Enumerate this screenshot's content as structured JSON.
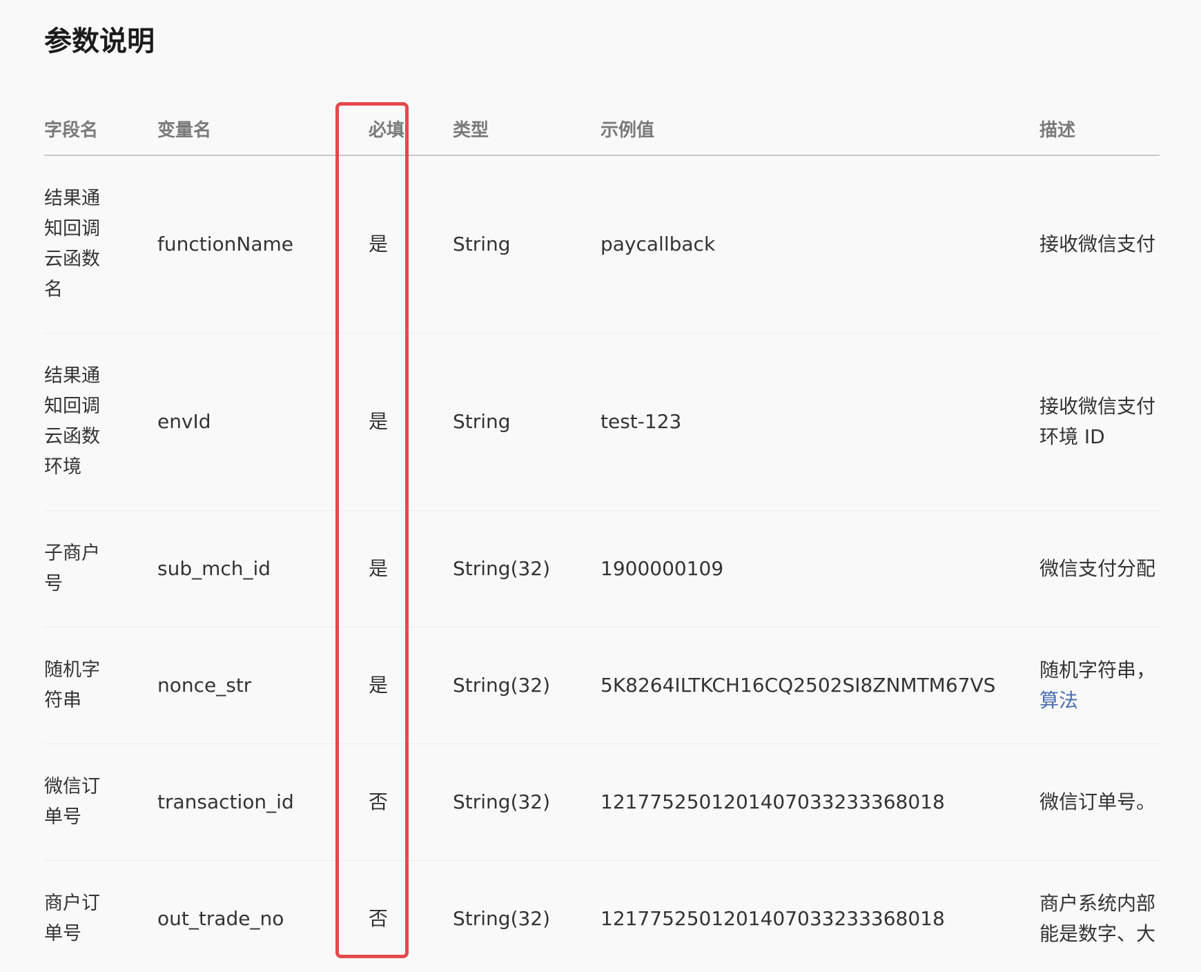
{
  "page": {
    "title": "参数说明"
  },
  "table": {
    "headers": {
      "field": "字段名",
      "variable": "变量名",
      "required": "必填",
      "type": "类型",
      "example": "示例值",
      "description": "描述"
    },
    "rows": [
      {
        "field": "结果通知回调云函数名",
        "variable": "functionName",
        "required": "是",
        "type": "String",
        "example": "paycallback",
        "description": [
          "接收微信支付"
        ],
        "description_link": ""
      },
      {
        "field": "结果通知回调云函数环境",
        "variable": "envId",
        "required": "是",
        "type": "String",
        "example": "test-123",
        "description": [
          "接收微信支付",
          "环境 ID"
        ],
        "description_link": ""
      },
      {
        "field": "子商户号",
        "variable": "sub_mch_id",
        "required": "是",
        "type": "String(32)",
        "example": "1900000109",
        "description": [
          "微信支付分配"
        ],
        "description_link": ""
      },
      {
        "field": "随机字符串",
        "variable": "nonce_str",
        "required": "是",
        "type": "String(32)",
        "example": "5K8264ILTKCH16CQ2502SI8ZNMTM67VS",
        "description": [
          "随机字符串，"
        ],
        "description_link": "算法"
      },
      {
        "field": "微信订单号",
        "variable": "transaction_id",
        "required": "否",
        "type": "String(32)",
        "example": "1217752501201407033233368018",
        "description": [
          "微信订单号。"
        ],
        "description_link": ""
      },
      {
        "field": "商户订单号",
        "variable": "out_trade_no",
        "required": "否",
        "type": "String(32)",
        "example": "1217752501201407033233368018",
        "description": [
          "商户系统内部",
          "能是数字、大"
        ],
        "description_link": ""
      }
    ]
  },
  "colors": {
    "highlight_border": "#e5484d",
    "link": "#4a6fb0",
    "header_text": "#7a7a7a",
    "body_text": "#333333",
    "background": "#f9f9f9"
  }
}
